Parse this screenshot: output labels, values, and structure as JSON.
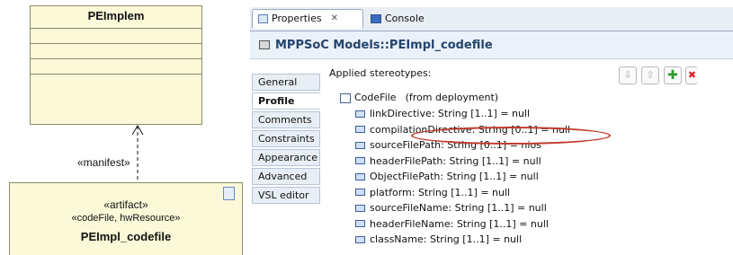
{
  "diagram": {
    "class_name": "PEImplem",
    "manifest_label": "«manifest»",
    "artifact": {
      "stereotype": "«artifact»",
      "applied_stereotypes": "«codeFile, hwResource»",
      "name": "PEImpl_codefile",
      "icon": "artifact-document-icon"
    }
  },
  "tabs": [
    {
      "label": "Properties",
      "icon": "properties-icon",
      "close": "✕"
    },
    {
      "label": "Console",
      "icon": "console-icon"
    }
  ],
  "title": "MPPSoC Models::PEImpl_codefile",
  "side_tabs": [
    "General",
    "Profile",
    "Comments",
    "Constraints",
    "Appearance",
    "Advanced",
    "VSL editor"
  ],
  "selected_side_tab": "Profile",
  "applied_stereotypes_label": "Applied stereotypes:",
  "toolbar": {
    "down": "⇩",
    "up": "⇧",
    "add": "✚",
    "delete": "✖"
  },
  "stereotype_tree": {
    "root": {
      "name": "CodeFile",
      "from": "(from deployment)"
    },
    "properties": [
      "linkDirective: String [1..1] = null",
      "compilationDirective: String [0..1] = null",
      "sourceFilePath: String [0..1] = nios",
      "headerFilePath: String [1..1] = null",
      "ObjectFilePath: String [1..1] = null",
      "platform: String [1..1] = null",
      "sourceFileName: String [1..1] = null",
      "headerFileName: String [1..1] = null",
      "className: String [1..1] = null"
    ]
  },
  "colors": {
    "highlight": "#c0392b",
    "uml_fill": "#fbf9d8",
    "title_text": "#23446e"
  }
}
